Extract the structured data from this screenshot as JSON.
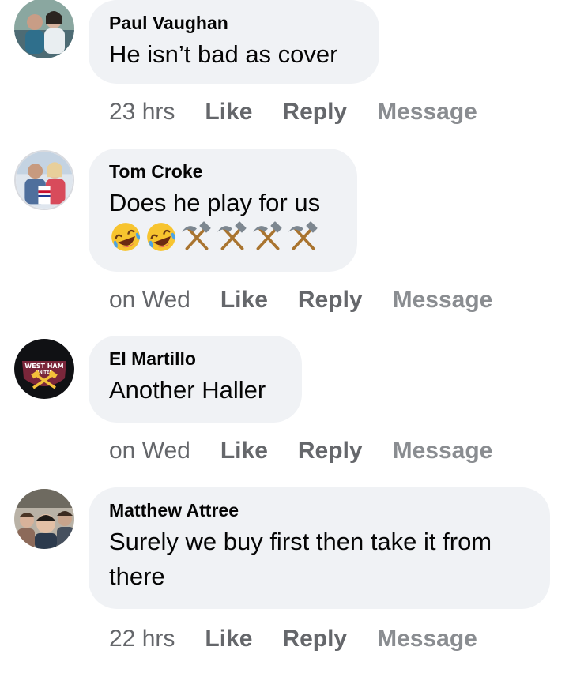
{
  "comments": [
    {
      "author": "Paul Vaughan",
      "text": "He isn’t bad as cover",
      "timestamp": "23 hrs",
      "like_label": "Like",
      "reply_label": "Reply",
      "message_label": "Message"
    },
    {
      "author": "Tom Croke",
      "text": "Does he play for us",
      "emojis": [
        "rofl-emoji",
        "rofl-emoji",
        "hammer-pick-emoji",
        "hammer-pick-emoji",
        "hammer-pick-emoji",
        "hammer-pick-emoji"
      ],
      "timestamp": "on Wed",
      "like_label": "Like",
      "reply_label": "Reply",
      "message_label": "Message"
    },
    {
      "author": "El Martillo",
      "text": "Another Haller",
      "avatar_badge": "WEST HAM UNITED",
      "timestamp": "on Wed",
      "like_label": "Like",
      "reply_label": "Reply",
      "message_label": "Message"
    },
    {
      "author": "Matthew Attree",
      "text": "Surely we buy first then take it from there",
      "timestamp": "22 hrs",
      "like_label": "Like",
      "reply_label": "Reply",
      "message_label": "Message"
    }
  ],
  "colors": {
    "bubble": "#f0f2f5",
    "meta_text": "#65676b",
    "message_text": "#8a8d91",
    "body_text": "#050505"
  }
}
